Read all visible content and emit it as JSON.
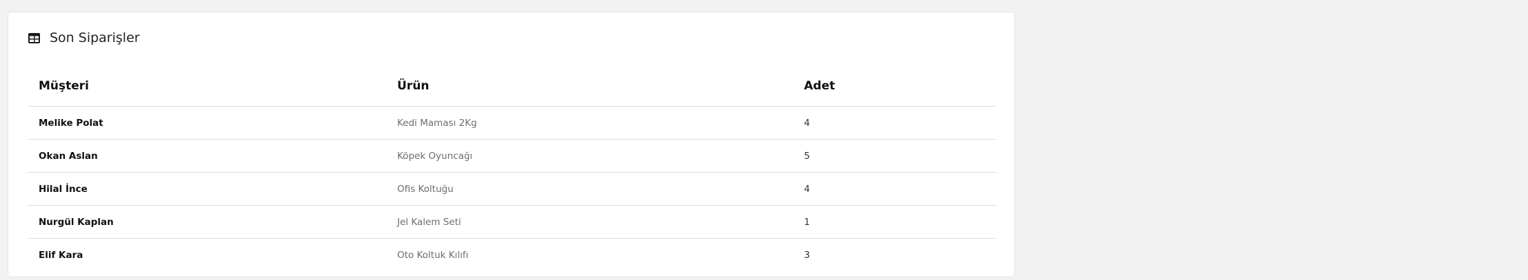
{
  "card": {
    "title": "Son Siparişler",
    "icon": "table-icon"
  },
  "table": {
    "headers": {
      "customer": "Müşteri",
      "product": "Ürün",
      "quantity": "Adet"
    },
    "rows": [
      {
        "customer": "Melike Polat",
        "product": "Kedi Maması 2Kg",
        "quantity": "4"
      },
      {
        "customer": "Okan Aslan",
        "product": "Köpek Oyuncağı",
        "quantity": "5"
      },
      {
        "customer": "Hilal İnce",
        "product": "Ofis Koltuğu",
        "quantity": "4"
      },
      {
        "customer": "Nurgül Kaplan",
        "product": "Jel Kalem Seti",
        "quantity": "1"
      },
      {
        "customer": "Elif Kara",
        "product": "Oto Koltuk Kılıfı",
        "quantity": "3"
      }
    ]
  },
  "colors": {
    "background": "#f2f2f2",
    "card": "#ffffff",
    "text": "#111111",
    "muted": "#6c6c6c",
    "border": "#dcdcdc"
  }
}
